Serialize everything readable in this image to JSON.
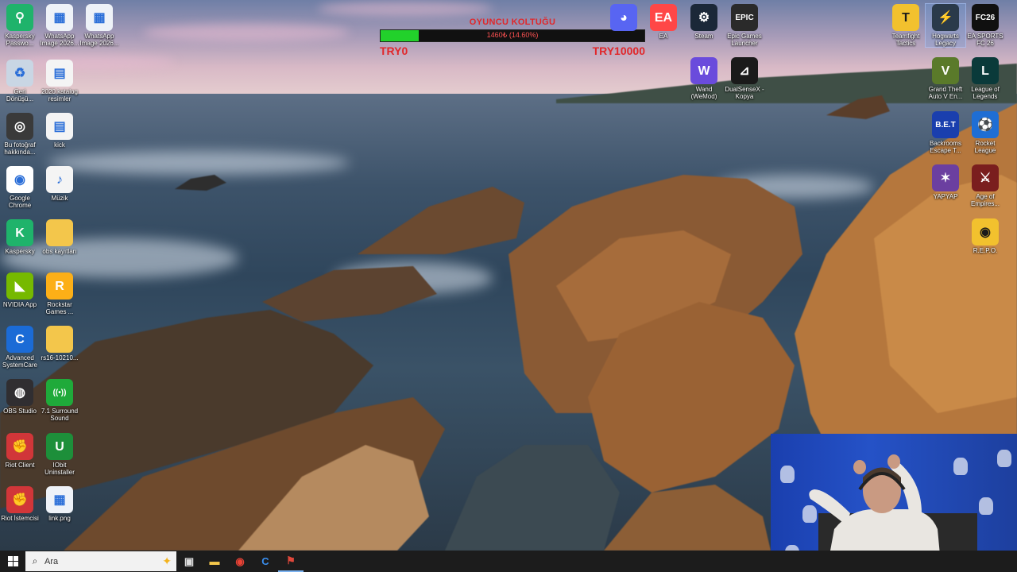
{
  "overlay": {
    "title": "OYUNCU KOLTUĞU",
    "progress_text": "1460₺ (14.60%)",
    "progress_fraction": 0.146,
    "min_label": "TRY0",
    "max_label": "TRY10000"
  },
  "desktop": {
    "left_icons": [
      {
        "label": "Kaspersky Passwo...",
        "icon": "kaspersky-password-icon"
      },
      {
        "label": "WhatsApp Image 2026...",
        "icon": "image-file-icon"
      },
      {
        "label": "WhatsApp Image 2026...",
        "icon": "image-file-icon"
      },
      {
        "label": "Geri Dönüşü...",
        "icon": "recycle-bin-icon"
      },
      {
        "label": "2020 katalog resimler",
        "icon": "file-icon"
      },
      {
        "label": "Bu fotoğraf hakkında...",
        "icon": "camera-icon"
      },
      {
        "label": "kick",
        "icon": "file-icon"
      },
      {
        "label": "Google Chrome",
        "icon": "chrome-icon"
      },
      {
        "label": "Müzik",
        "icon": "music-file-icon"
      },
      {
        "label": "Kaspersky",
        "icon": "kaspersky-icon"
      },
      {
        "label": "obs kayıtları",
        "icon": "folder-icon"
      },
      {
        "label": "NVIDIA App",
        "icon": "nvidia-icon"
      },
      {
        "label": "Rockstar Games ...",
        "icon": "rockstar-icon"
      },
      {
        "label": "Advanced SystemCare",
        "icon": "systemcare-icon"
      },
      {
        "label": "rs16-10210...",
        "icon": "folder-icon"
      },
      {
        "label": "OBS Studio",
        "icon": "obs-icon"
      },
      {
        "label": "7.1 Surround Sound",
        "icon": "surround-sound-icon"
      },
      {
        "label": "Riot Client",
        "icon": "riot-icon"
      },
      {
        "label": "IObit Uninstaller",
        "icon": "uninstaller-icon"
      },
      {
        "label": "Riot İstemcisi",
        "icon": "riot-icon"
      },
      {
        "label": "link.png",
        "icon": "image-file-icon"
      }
    ],
    "top_icons": [
      {
        "label": "",
        "icon": "discord-icon"
      },
      {
        "label": "EA",
        "icon": "ea-icon"
      },
      {
        "label": "Steam",
        "icon": "steam-icon"
      },
      {
        "label": "Epic Games Launcher",
        "icon": "epic-games-icon",
        "glyph": "EPIC"
      },
      {
        "label": "Wand (WeMod)",
        "icon": "wand-icon"
      },
      {
        "label": "DualSenseX - Kopya",
        "icon": "dualsensex-icon"
      }
    ],
    "right_icons": [
      {
        "label": "Teamfight Tactics",
        "icon": "tft-icon"
      },
      {
        "label": "Hogwarts Legacy",
        "icon": "hogwarts-icon"
      },
      {
        "label": "EA SPORTS FC 26",
        "icon": "fc26-icon",
        "glyph": "FC26"
      },
      {
        "label": "Grand Theft Auto V En...",
        "icon": "gta-icon",
        "glyph": "V"
      },
      {
        "label": "League of Legends",
        "icon": "lol-icon",
        "glyph": "L"
      },
      {
        "label": "Backrooms Escape T...",
        "icon": "backrooms-icon",
        "glyph": "B.E.T"
      },
      {
        "label": "Rocket League",
        "icon": "rocket-league-icon"
      },
      {
        "label": "YAPYAP",
        "icon": "yapyap-icon"
      },
      {
        "label": "Age of Empires...",
        "icon": "aoe-icon"
      },
      {
        "label": "R.E.P.O.",
        "icon": "repo-icon"
      }
    ]
  },
  "taskbar": {
    "search_placeholder": "Ara",
    "apps": [
      {
        "name": "task-view-icon",
        "glyph": "▣"
      },
      {
        "name": "file-explorer-icon",
        "glyph": "▬"
      },
      {
        "name": "chrome-icon",
        "glyph": "◉"
      },
      {
        "name": "systemcare-icon",
        "glyph": "C"
      },
      {
        "name": "riot-client-icon",
        "glyph": "⚑"
      }
    ]
  },
  "colors": {
    "overlay_accent": "#e1272a",
    "progress_fill": "#22d12b",
    "taskbar_bg": "#1c1c1c"
  }
}
